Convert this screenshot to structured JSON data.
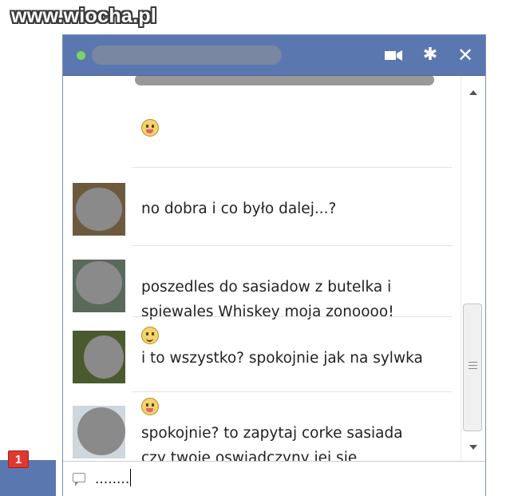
{
  "watermark": {
    "text": "www.wiocha.pl"
  },
  "chat_window": {
    "title": "",
    "status": "online",
    "header_icons": [
      "video-icon",
      "gear-icon",
      "close-icon"
    ],
    "messages": [
      {
        "text": "no dobra i co było dalej...?",
        "emoji": null
      },
      {
        "text": "poszedles do sasiadow z butelka i\nspiewales Whiskey moja zonoooo!",
        "emoji": "smile-emoji"
      },
      {
        "text": "i to wszystko? spokojnie jak na sylwka",
        "emoji": "tongue-emoji"
      },
      {
        "text": "spokojnie? to zapytaj corke sasiada\nczy twoje oswiadczyny jej sie\npodobaly",
        "emoji": null
      }
    ],
    "composer": {
      "value": "........"
    }
  },
  "notifications": {
    "count": "1"
  },
  "colors": {
    "header": "#5b77b0",
    "online": "#7dd35f",
    "badge": "#e0382f"
  }
}
